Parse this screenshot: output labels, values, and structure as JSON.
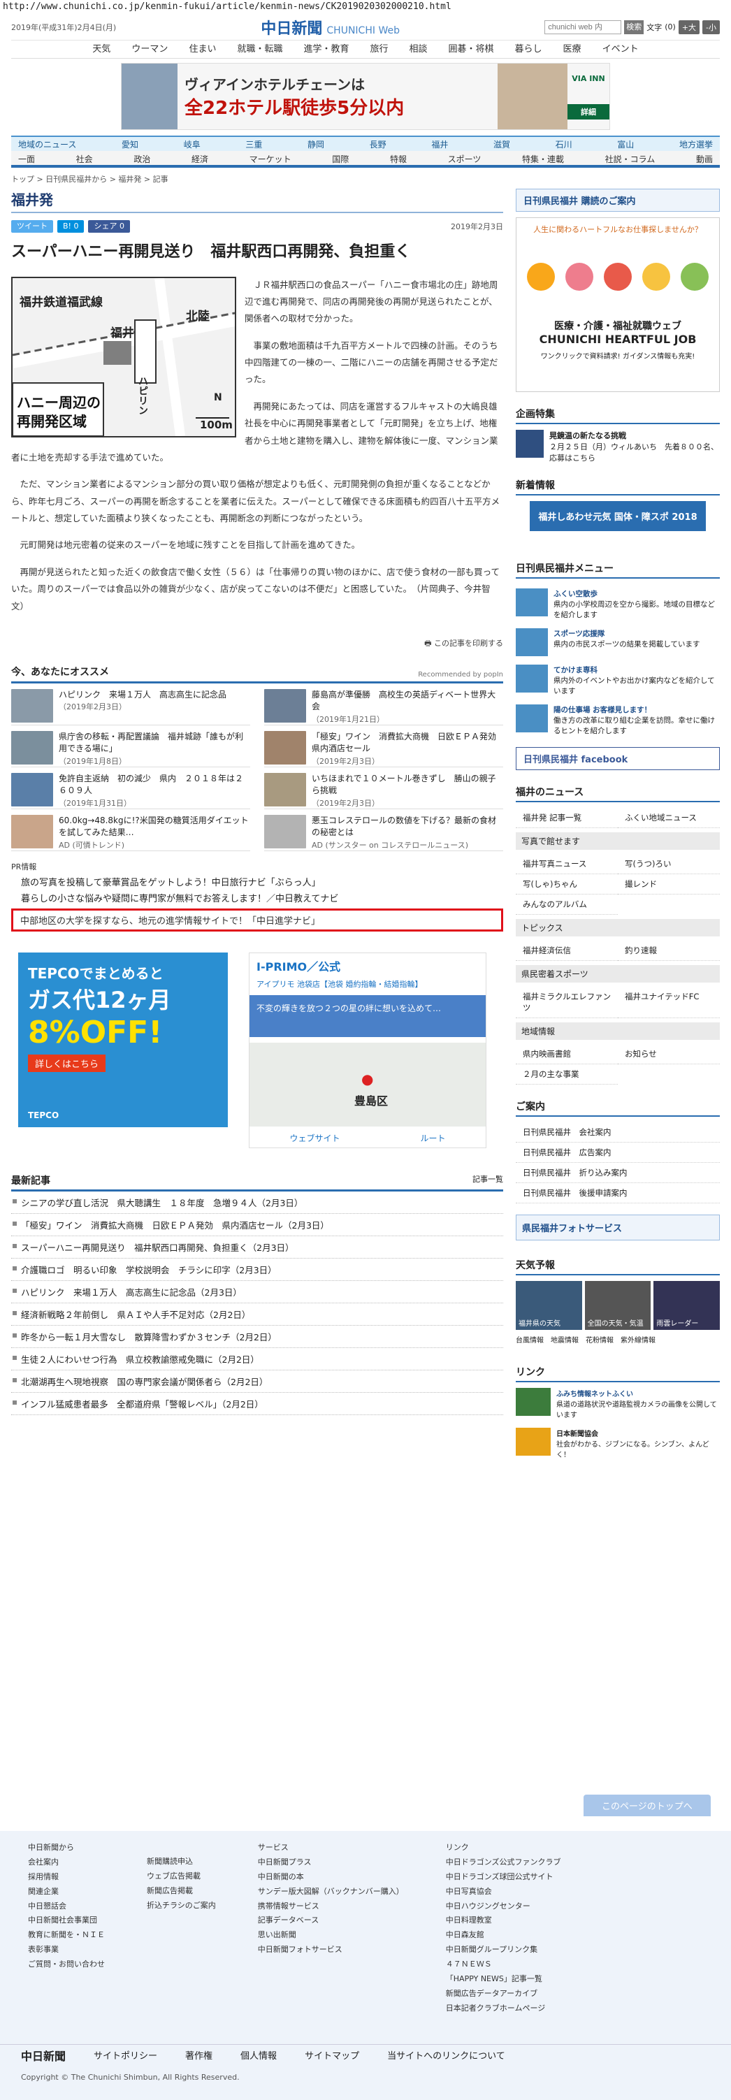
{
  "url": "http://www.chunichi.co.jp/kenmin-fukui/article/kenmin-news/CK2019020302000210.html",
  "header": {
    "date": "2019年(平成31年)2月4日(月)",
    "logo": "中日新聞",
    "logo_sub": "CHUNICHI Web",
    "search_placeholder": "chunichi web 内",
    "search_btn": "検索",
    "size_label": "文字",
    "size_val": "(0)",
    "size_up": "+大",
    "size_down": "-小"
  },
  "gnav": [
    "天気",
    "ウーマン",
    "住まい",
    "就職・転職",
    "進学・教育",
    "旅行",
    "相談",
    "囲碁・将棋",
    "暮らし",
    "医療",
    "イベント"
  ],
  "banner": {
    "l1": "ヴィアインホテルチェーンは",
    "l2": "全22ホテル駅徒歩5分以内",
    "brand": "VIA INN",
    "more": "詳細"
  },
  "regions": [
    "地域のニュース",
    "愛知",
    "岐阜",
    "三重",
    "静岡",
    "長野",
    "福井",
    "滋賀",
    "石川",
    "富山",
    "地方選挙"
  ],
  "cats": [
    "一面",
    "社会",
    "政治",
    "経済",
    "マーケット",
    "国際",
    "特報",
    "スポーツ",
    "特集・連載",
    "社説・コラム",
    "動画"
  ],
  "breadcrumb": "トップ > 日刊県民福井から > 福井発 > 記事",
  "section": "福井発",
  "share": {
    "tw": "ツイート",
    "hb": "B! 0",
    "fb": "シェア 0",
    "date": "2019年2月3日"
  },
  "headline": "スーパーハニー再開見送り　福井駅西口再開発、負担重く",
  "map": {
    "rail": "福井鉄道福武線",
    "station": "福井",
    "street": "北陸",
    "label1": "ハニー周辺の",
    "label2": "再開発区域",
    "honey": "ハピリン",
    "scale": "100m",
    "north": "N"
  },
  "paragraphs": [
    "ＪＲ福井駅西口の食品スーパー「ハニー食市場北の庄」跡地周辺で進む再開発で、同店の再開発後の再開が見送られたことが、関係者への取材で分かった。",
    "事業の敷地面積は千九百平方メートルで四棟の計画。そのうち中四階建ての一棟の一、二階にハニーの店舗を再開させる予定だった。",
    "再開発にあたっては、同店を運営するフルキャストの大嶋良雄社長を中心に再開発事業者として「元町開発」を立ち上げ、地権者から土地と建物を購入し、建物を解体後に一度、マンション業者に土地を売却する手法で進めていた。",
    "ただ、マンション業者によるマンション部分の買い取り価格が想定よりも低く、元町開発側の負担が重くなることなどから、昨年七月ごろ、スーパーの再開を断念することを業者に伝えた。スーパーとして確保できる床面積も約四百八十五平方メートルと、想定していた面積より狭くなったことも、再開断念の判断につながったという。",
    "元町開発は地元密着の従来のスーパーを地域に残すことを目指して計画を進めてきた。",
    "再開が見送られたと知った近くの飲食店で働く女性（５６）は「仕事帰りの買い物のほかに、店で使う食材の一部も買っていた。周りのスーパーでは食品以外の雑貨が少なく、店が戻ってこないのは不便だ」と困惑していた。　（片岡典子、今井智文）"
  ],
  "print_label": "この記事を印刷する",
  "rec": {
    "title": "今、あなたにオススメ",
    "powered": "Recommended by popIn",
    "items": [
      {
        "t": "ハピリンク　来場１万人　高志高生に記念品",
        "d": "（2019年2月3日）"
      },
      {
        "t": "藤島高が準優勝　高校生の英語ディベート世界大会",
        "d": "（2019年1月21日）"
      },
      {
        "t": "県庁舎の移転・再配置議論　福井城跡「誰もが利用できる場に」",
        "d": "（2019年1月8日）"
      },
      {
        "t": "「極安」ワイン　消費拡大商機　日欧ＥＰＡ発効　県内酒店セール",
        "d": "（2019年2月3日）"
      },
      {
        "t": "免許自主返納　初の減少　県内　２０１８年は２６０９人",
        "d": "（2019年1月31日）"
      },
      {
        "t": "いちほまれで１０メートル巻きずし　勝山の親子ら挑戦",
        "d": "（2019年2月3日）"
      },
      {
        "t": "60.0kg→48.8kgに!?米国発の糖質活用ダイエットを試してみた結果…",
        "d": "AD (可憐トレンド)"
      },
      {
        "t": "悪玉コレステロールの数値を下げる？最新の食材の秘密とは",
        "d": "AD (サンスター on コレステロールニュース)"
      }
    ]
  },
  "pr": {
    "label": "PR情報",
    "l1": "旅の写真を投稿して豪華賞品をゲットしよう！中日旅行ナビ「ぶらっ人」",
    "l2": "暮らしの小さな悩みや疑問に専門家が無料でお答えします！／中日教えてナビ",
    "hl": "中部地区の大学を探すなら、地元の進学情報サイトで！「中日進学ナビ」"
  },
  "ad1": {
    "a": "TEPCOでまとめると",
    "b": "ガス代12ヶ月",
    "c": "8%OFF!",
    "d": "詳しくはこちら",
    "e": "TEPCO"
  },
  "ad2": {
    "h": "I-PRIMO／公式",
    "s": "アイプリモ 池袋店【池袋 婚約指輪・結婚指輪】",
    "m": "不変の輝きを放つ２つの星の絆に想いを込めて…",
    "city": "豊島区",
    "b1": "ウェブサイト",
    "b2": "ルート"
  },
  "latest": {
    "title": "最新記事",
    "more": "記事一覧",
    "items": [
      "シニアの学び直し活況　県大聴講生　１８年度　急増９４人（2月3日）",
      "「極安」ワイン　消費拡大商機　日欧ＥＰＡ発効　県内酒店セール（2月3日）",
      "スーパーハニー再開見送り　福井駅西口再開発、負担重く（2月3日）",
      "介護職ロゴ　明るい印象　学校説明会　チラシに印字（2月3日）",
      "ハピリンク　来場１万人　高志高生に記念品（2月3日）",
      "経済新戦略２年前倒し　県ＡＩや人手不足対応（2月2日）",
      "昨冬から一転１月大雪なし　散算降雪わずか３センチ（2月2日）",
      "生徒２人にわいせつ行為　県立校教諭懲戒免職に（2月2日）",
      "北潮湖再生へ現地視察　国の専門家会議が関係者ら（2月2日）",
      "インフル猛威患者最多　全都道府県「警報レベル」（2月2日）"
    ]
  },
  "side": {
    "subs": "日刊県民福井 購読のご案内",
    "jobad": {
      "t1": "人生に関わるハートフルなお仕事探しませんか？",
      "t2": "医療・介護・福祉就職ウェブ",
      "t3": "CHUNICHI HEARTFUL JOB",
      "t4": "ワンクリックで資料請求! ガイダンス情報も充実!"
    },
    "feature": "企画特集",
    "f1": "晃鏡温の新たなる挑戦",
    "f2": "２月２５日（月）ウィルあいち　先着８００名、応募はこちら",
    "newpost": "新着情報",
    "np": "福井しあわせ元気 国体・障スポ 2018",
    "menu": "日刊県民福井メニュー",
    "menu_items": [
      {
        "t": "ふくい空散歩",
        "d": "県内の小学校周辺を空から撮影。地域の目標などを紹介します"
      },
      {
        "t": "スポーツ応援隊",
        "d": "県内の市民スポーツの結果を掲載しています"
      },
      {
        "t": "てかけま専科",
        "d": "県内外のイベントやお出かけ案内などを紹介しています"
      },
      {
        "t": "陽の仕事場 お客様見します！",
        "d": "働き方の改革に取り組む企業を訪問。幸せに働けるヒントを紹介します"
      }
    ],
    "fb": "日刊県民福井 facebook",
    "news": "福井のニュース",
    "news_links": [
      "福井発 記事一覧",
      "ふくい地域ニュース"
    ],
    "photo": "写真で館せます",
    "photo_links": [
      "福井写真ニュース",
      "写(うつ)ろい",
      "写(しゃ)ちゃん",
      "撮レンド",
      "みんなのアルバム"
    ],
    "topics": "トピックス",
    "topics_links": [
      "福井経済伝信",
      "釣り速報"
    ],
    "sports": "県民密着スポーツ",
    "sports_links": [
      "福井ミラクルエレファンツ",
      "福井ユナイテッドFC"
    ],
    "region": "地域情報",
    "region_links": [
      "県内映画書館",
      "お知らせ",
      "２月の主な事業"
    ],
    "guide": "ご案内",
    "guide_links": [
      "日刊県民福井　会社案内",
      "日刊県民福井　広告案内",
      "日刊県民福井　折り込み案内",
      "日刊県民福井　後援申請案内"
    ],
    "service": "県民福井フォトサービス",
    "weather": "天気予報",
    "w1": "福井県の天気",
    "w2": "全国の天気・気温",
    "w3": "雨雲レーダー",
    "wl": [
      "台風情報",
      "地震情報",
      "花粉情報",
      "紫外線情報"
    ],
    "link": "リンク",
    "link1t": "ふみち情報ネットふくい",
    "link1d": "県道の道路状況や道路監視カメラの画像を公開しています",
    "link2t": "日本新聞協会",
    "link2d": "社会がわかる、ジブンになる。シンブン、よんどく！"
  },
  "totop": "このページのトップへ",
  "footer": {
    "c1": [
      "中日新聞から",
      "会社案内",
      "採用情報",
      "関連企業",
      "中日懇話会",
      "中日新聞社会事業団",
      "教育に新聞を・ＮＩＥ",
      "表彰事業",
      "ご質問・お問い合わせ"
    ],
    "c2": [
      "新聞購読申込",
      "ウェブ広告掲載",
      "新聞広告掲載",
      "折込チラシのご案内"
    ],
    "c3": [
      "サービス",
      "中日新聞プラス",
      "中日新聞の本",
      "サンデー版大図解（バックナンバー購入）",
      "携帯情報サービス",
      "記事データベース",
      "思い出新聞",
      "中日新聞フォトサービス"
    ],
    "c4": [
      "リンク",
      "中日ドラゴンズ公式ファンクラブ",
      "中日ドラゴンズ球団公式サイト",
      "中日写真協会",
      "中日ハウジングセンター",
      "中日料理教室",
      "中日森友館",
      "中日新聞グループリンク集",
      "４７ＮＥＷＳ",
      "「HAPPY NEWS」記事一覧",
      "新聞広告データアーカイブ",
      "日本記者クラブホームページ"
    ],
    "bot": [
      "中日新聞",
      "サイトポリシー",
      "著作権",
      "個人情報",
      "サイトマップ",
      "当サイトへのリンクについて"
    ],
    "copy": "Copyright © The Chunichi Shimbun, All Rights Reserved."
  }
}
